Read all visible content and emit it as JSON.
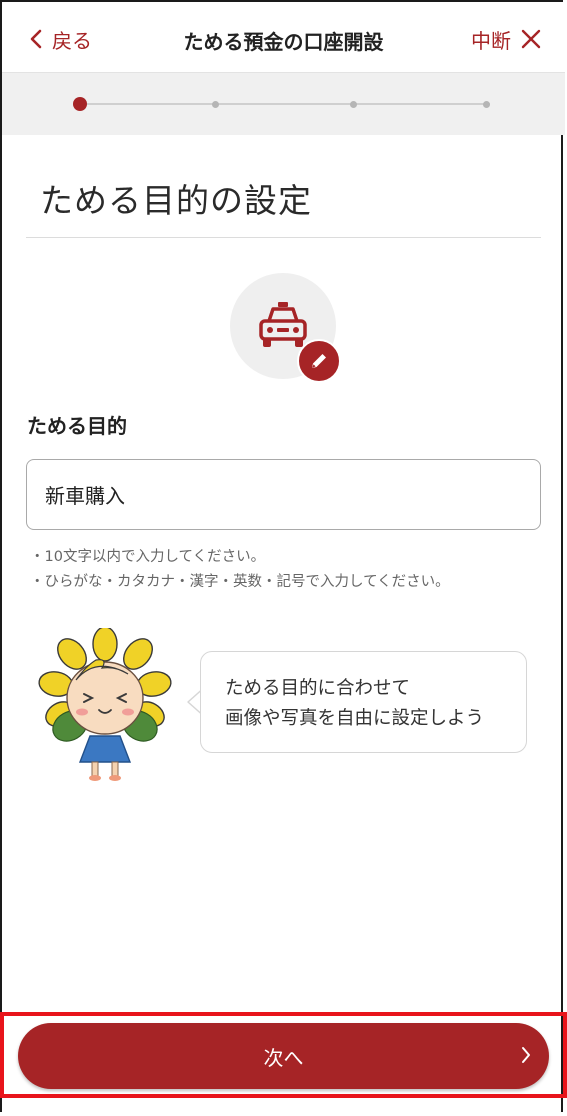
{
  "header": {
    "back_label": "戻る",
    "title": "ためる預金の口座開設",
    "abort_label": "中断"
  },
  "progress": {
    "current_step": 1,
    "total_steps": 4
  },
  "section": {
    "title": "ためる目的の設定"
  },
  "goal_icon": {
    "icon": "car-icon",
    "badge_icon": "pencil-icon"
  },
  "field": {
    "label": "ためる目的",
    "value": "新車購入",
    "hints": [
      "・10文字以内で入力してください。",
      "・ひらがな・カタカナ・漢字・英数・記号で入力してください。"
    ]
  },
  "mascot": {
    "icon": "sunflower-mascot",
    "message_lines": [
      "ためる目的に合わせて",
      "画像や写真を自由に設定しよう"
    ]
  },
  "footer": {
    "next_label": "次へ"
  },
  "colors": {
    "accent": "#a62426",
    "highlight": "#e8141b"
  }
}
